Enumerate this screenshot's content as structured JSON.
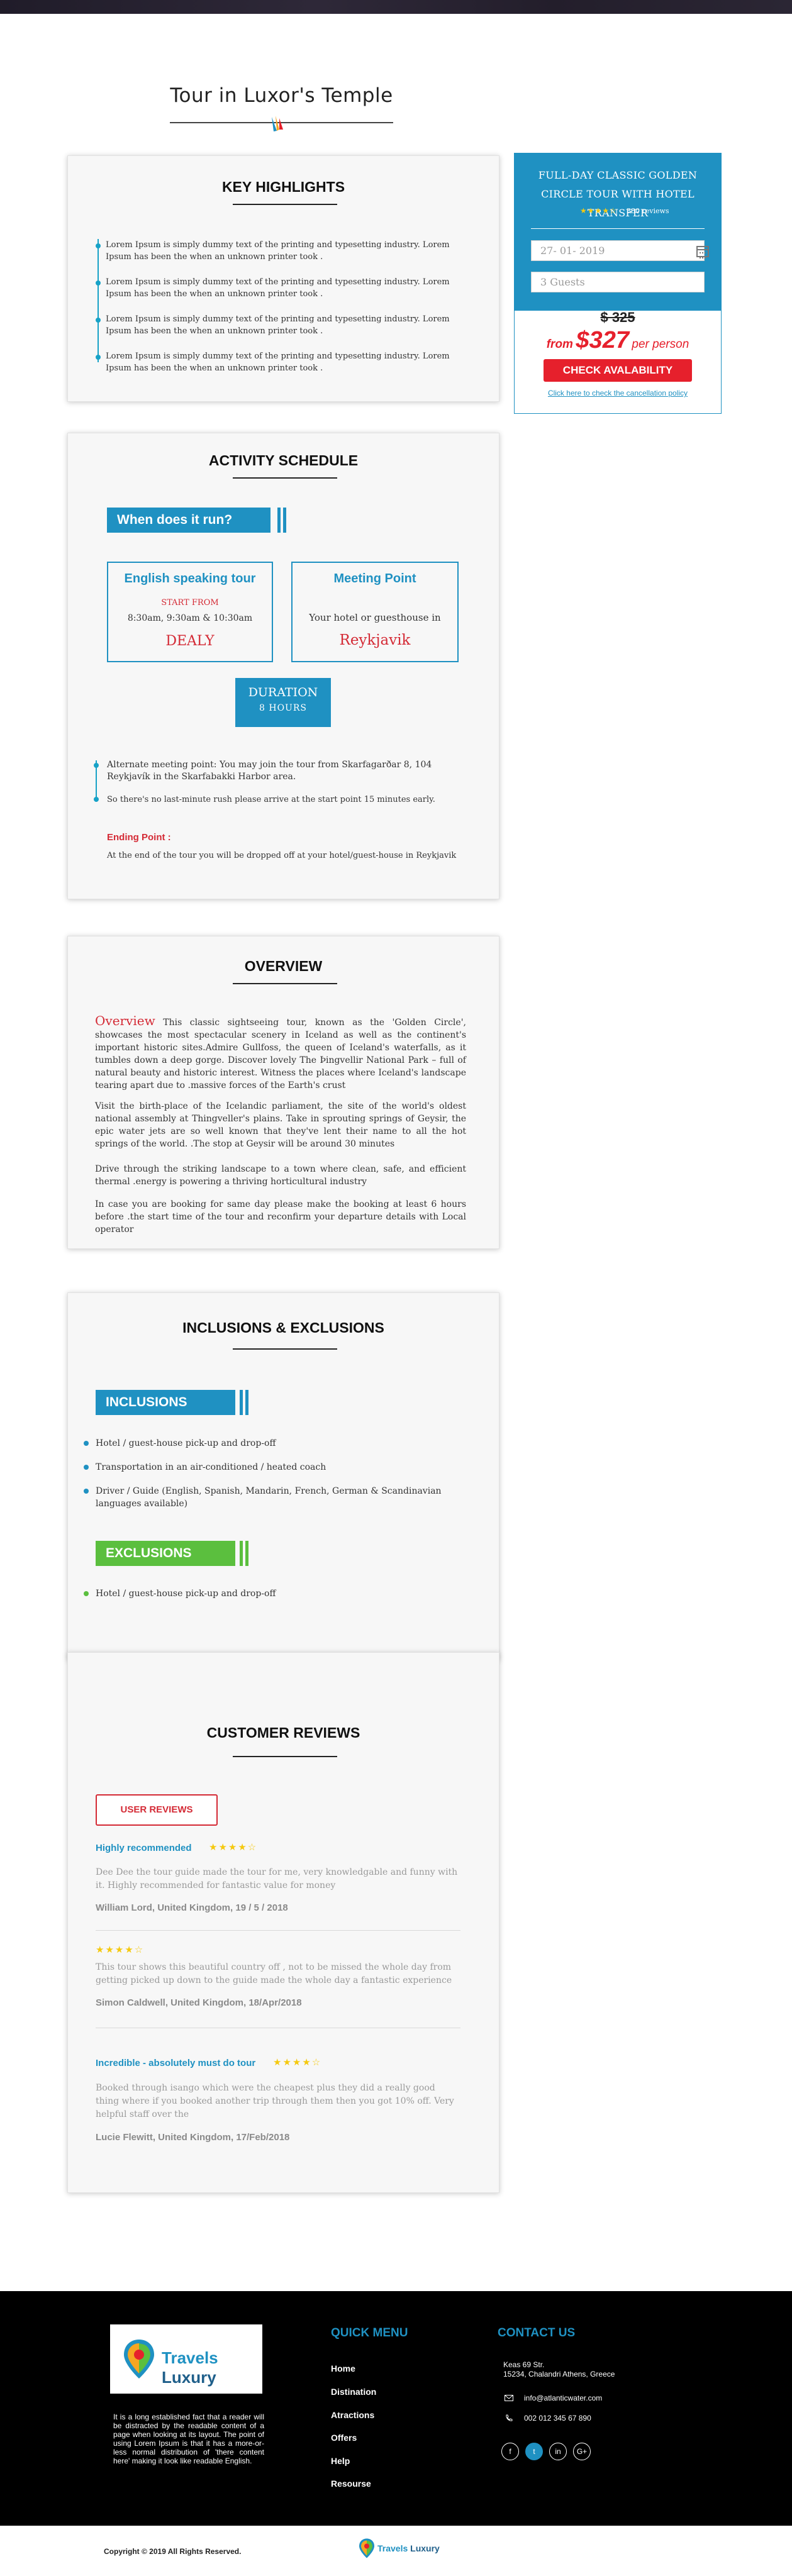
{
  "page": {
    "title": "Tour in Luxor's Temple"
  },
  "highlights": {
    "title": "KEY HIGHLIGHTS",
    "items": [
      "Lorem Ipsum is simply dummy text of the printing and typesetting industry. Lorem Ipsum has been the when an unknown printer took .",
      "Lorem Ipsum is simply dummy text of the printing and typesetting industry. Lorem Ipsum has been the when an unknown printer took .",
      "Lorem Ipsum is simply dummy text of the printing and typesetting industry. Lorem Ipsum has been the when an unknown printer took .",
      "Lorem Ipsum is simply dummy text of the printing and typesetting industry. Lorem Ipsum has been the when an unknown printer took ."
    ]
  },
  "booking": {
    "title": "FULL-DAY CLASSIC GOLDEN CIRCLE TOUR  WITH HOTEL TRANSFER",
    "stars": "★★★★☆",
    "reviews": "380 reviews",
    "date_value": "27- 01- 2019",
    "guests_value": "3 Guests",
    "old_price": "$ 325",
    "from": "from",
    "price": "$327",
    "per": "per person",
    "button": "CHECK AVALABILITY",
    "cancel_link": "Click here to check the cancellation policy"
  },
  "schedule": {
    "title": "ACTIVITY SCHEDULE",
    "ribbon": "When does it run?",
    "tour_box": {
      "title": "English speaking tour",
      "subtitle": "START FROM",
      "times": "8:30am, 9:30am & 10:30am",
      "frequency": "DEALY"
    },
    "meeting_box": {
      "title": "Meeting Point",
      "text": "Your hotel or guesthouse in",
      "city": "Reykjavik"
    },
    "duration_label": "DURATION",
    "duration_value": "8 HOURS",
    "notes": [
      "Alternate meeting point: You may join the tour from Skarfagarðar 8, 104 Reykjavík in the Skarfabakki Harbor area.",
      "So there's no last-minute rush please arrive at the start point 15 minutes early."
    ],
    "ending_label": "Ending Point :",
    "ending_text": "At the end of the tour you will be dropped off at your hotel/guest-house in Reykjavik"
  },
  "overview": {
    "title": "OVERVIEW",
    "lead_word": "Overview",
    "p1": "This classic sightseeing tour, known as the 'Golden Circle', showcases the most spectacular scenery in Iceland as well as the continent's important historic sites.Admire Gullfoss, the queen of Iceland's waterfalls, as it tumbles down a deep gorge. Discover lovely The Þingvellir National Park – full of natural beauty and historic interest. Witness the places where Iceland's landscape tearing apart due to .massive forces of the Earth's crust",
    "p2": "Visit the birth-place of the Icelandic parliament, the site of the world's oldest national assembly at Thingveller's plains. Take in sprouting springs of Geysir, the epic water jets are so well known that they've lent their name to all the hot springs of the world. .The stop at Geysir will be around 30 minutes",
    "p3": "Drive through the striking landscape to a town where clean, safe, and efficient thermal .energy is powering a thriving horticultural industry",
    "p4": "In case you are booking for same day please make the booking at least 6 hours before .the start time of the tour and reconfirm your departure details with Local operator"
  },
  "inclusions": {
    "title": "INCLUSIONS & EXCLUSIONS",
    "incl_label": "INCLUSIONS",
    "incl_items": [
      "Hotel / guest-house pick-up and drop-off",
      "Transportation in an air-conditioned / heated coach",
      "Driver / Guide (English, Spanish, Mandarin, French, German & Scandinavian languages available)"
    ],
    "excl_label": "EXCLUSIONS",
    "excl_items": [
      "Hotel / guest-house pick-up and drop-off"
    ],
    "incl_color": "#1f91c2",
    "excl_color": "#5bbf3e"
  },
  "reviews": {
    "title": "CUSTOMER REVIEWS",
    "button": "USER REVIEWS",
    "items": [
      {
        "title": "Highly recommended",
        "stars": "★★★★☆",
        "body": "Dee Dee the tour guide made the tour for me, very knowledgable and funny with it. Highly recommended for fantastic value for money",
        "author": "William Lord, United Kingdom, 19 / 5 / 2018"
      },
      {
        "title": "",
        "stars": "★★★★☆",
        "body": "This tour shows this beautiful country off , not to be missed the whole day from getting picked up down to the guide made the whole day a fantastic experience",
        "author": "Simon Caldwell, United Kingdom, 18/Apr/2018"
      },
      {
        "title": "Incredible - absolutely must do tour",
        "stars": "★★★★☆",
        "body": "Booked through isango which were the cheapest plus they did a really good thing where if you booked another trip through them then you got 10% off. Very helpful staff over the",
        "author": "Lucie Flewitt, United Kingdom, 17/Feb/2018"
      }
    ]
  },
  "footer": {
    "brand_a": "Travels",
    "brand_b": "Luxury",
    "about": "It is a long established fact that a reader will be distracted by the readable content of a page when looking at its layout. The point of using Lorem Ipsum is that it has a more-or-less normal distribution of 'there content here' making it look like readable English.",
    "menu_title": "QUICK MENU",
    "menu": [
      "Home",
      "Distination",
      "Atractions",
      "Offers",
      "Help",
      "Resourse"
    ],
    "contact_title": "CONTACT US",
    "address_1": "Keas 69 Str.",
    "address_2": "15234, Chalandri Athens, Greece",
    "email": "info@atlanticwater.com",
    "phone": "002 012 345 67 890",
    "social": [
      "f",
      "t",
      "in",
      "G+"
    ],
    "copyright": "Copyright © 2019 All Rights Reserved."
  }
}
